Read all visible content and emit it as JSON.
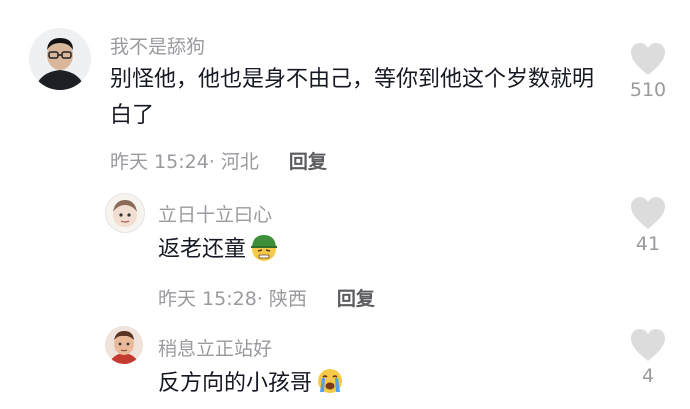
{
  "comments": [
    {
      "username": "我不是舔狗",
      "text": "别怪他，他也是身不由己，等你到他这个岁数就明白了",
      "time": "昨天 15:24",
      "location": "河北",
      "reply_label": "回复",
      "likes": "510",
      "avatar": "man-with-glasses-avatar"
    },
    {
      "username": "立日十立曰心",
      "text": "返老还童",
      "emoji": "green-hat-grimace-emoji",
      "time": "昨天 15:28",
      "location": "陕西",
      "reply_label": "回复",
      "likes": "41",
      "avatar": "cartoon-face-avatar"
    },
    {
      "username": "稍息立正站好",
      "text": "反方向的小孩哥",
      "emoji": "loudly-crying-emoji",
      "likes": "4",
      "avatar": "cartoon-boy-avatar"
    }
  ],
  "colors": {
    "like_icon": "#dcdcdc",
    "muted_text": "#9a9a9f",
    "main_text": "#161823"
  }
}
